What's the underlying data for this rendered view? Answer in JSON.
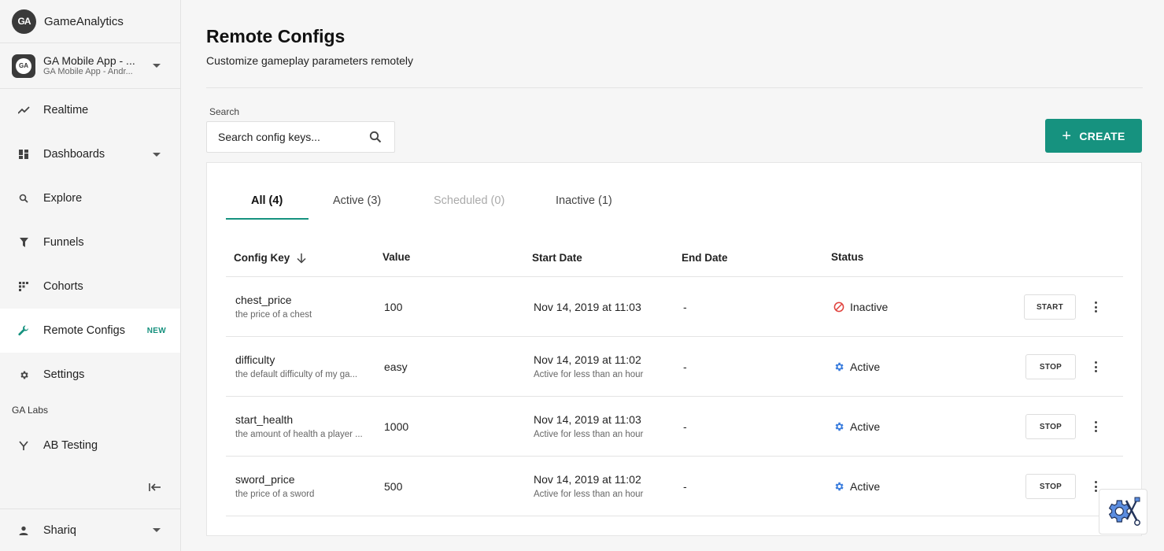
{
  "brand": {
    "name": "GameAnalytics",
    "logo_text": "GA"
  },
  "game": {
    "title": "GA Mobile App - ...",
    "subtitle": "GA Mobile App - Andr...",
    "icon_text": "GA"
  },
  "nav": {
    "realtime": "Realtime",
    "dashboards": "Dashboards",
    "explore": "Explore",
    "funnels": "Funnels",
    "cohorts": "Cohorts",
    "remote_configs": "Remote Configs",
    "remote_configs_badge": "NEW",
    "settings": "Settings",
    "labs_section": "GA Labs",
    "ab_testing": "AB Testing"
  },
  "user": {
    "name": "Shariq"
  },
  "page": {
    "title": "Remote Configs",
    "subtitle": "Customize gameplay parameters remotely"
  },
  "search": {
    "label": "Search",
    "placeholder": "Search config keys..."
  },
  "create_label": "CREATE",
  "tabs": [
    {
      "label": "All (4)",
      "selected": true
    },
    {
      "label": "Active (3)"
    },
    {
      "label": "Scheduled (0)",
      "disabled": true
    },
    {
      "label": "Inactive (1)"
    }
  ],
  "table": {
    "headers": {
      "config_key": "Config Key",
      "value": "Value",
      "start_date": "Start Date",
      "end_date": "End Date",
      "status": "Status"
    },
    "rows": [
      {
        "key": "chest_price",
        "desc": "the price of a chest",
        "value": "100",
        "start": "Nov 14, 2019 at 11:03",
        "start_sub": "",
        "end": "-",
        "status": "Inactive",
        "action": "START"
      },
      {
        "key": "difficulty",
        "desc": "the default difficulty of my ga...",
        "value": "easy",
        "start": "Nov 14, 2019 at 11:02",
        "start_sub": "Active for less than an hour",
        "end": "-",
        "status": "Active",
        "action": "STOP"
      },
      {
        "key": "start_health",
        "desc": "the amount of health a player ...",
        "value": "1000",
        "start": "Nov 14, 2019 at 11:03",
        "start_sub": "Active for less than an hour",
        "end": "-",
        "status": "Active",
        "action": "STOP"
      },
      {
        "key": "sword_price",
        "desc": "the price of a sword",
        "value": "500",
        "start": "Nov 14, 2019 at 11:02",
        "start_sub": "Active for less than an hour",
        "end": "-",
        "status": "Active",
        "action": "STOP"
      }
    ]
  },
  "colors": {
    "accent": "#16927f",
    "inactive": "#e0413c",
    "active": "#3b7ddd"
  },
  "icons": {
    "realtime": "trend-line-icon",
    "dashboards": "grid-icon",
    "explore": "magnifier-icon",
    "funnels": "funnel-icon",
    "cohorts": "dots-grid-icon",
    "remote_configs": "wrench-icon",
    "settings": "gear-icon",
    "ab_testing": "fork-icon",
    "user": "person-icon"
  }
}
